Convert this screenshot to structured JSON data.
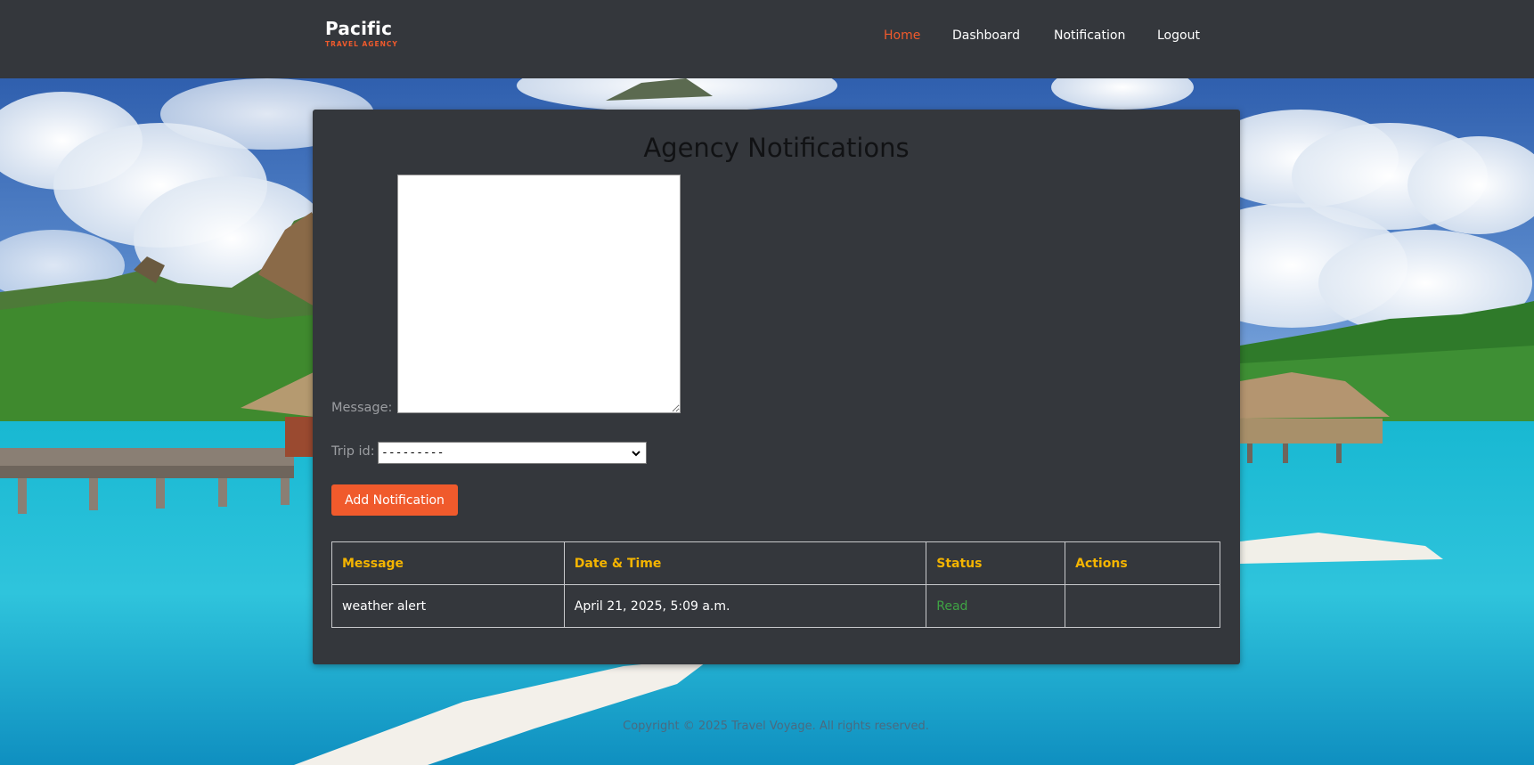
{
  "brand": {
    "name": "Pacific",
    "subtitle": "TRAVEL AGENCY"
  },
  "nav": {
    "items": [
      {
        "label": "Home",
        "active": true
      },
      {
        "label": "Dashboard",
        "active": false
      },
      {
        "label": "Notification",
        "active": false
      },
      {
        "label": "Logout",
        "active": false
      }
    ]
  },
  "page": {
    "title": "Agency Notifications"
  },
  "form": {
    "message_label": "Message:",
    "message_value": "",
    "trip_label": "Trip id:",
    "trip_selected": "---------",
    "submit_label": "Add Notification"
  },
  "table": {
    "headers": [
      "Message",
      "Date & Time",
      "Status",
      "Actions"
    ],
    "rows": [
      {
        "message": "weather alert",
        "datetime": "April 21, 2025, 5:09 a.m.",
        "status": "Read",
        "actions": ""
      }
    ]
  },
  "footer": {
    "text": "Copyright © 2025 Travel Voyage. All rights reserved."
  },
  "colors": {
    "accent": "#f05a2c",
    "header_text": "#f4b400",
    "status_read": "#3fa444",
    "panel": "#34373c"
  }
}
